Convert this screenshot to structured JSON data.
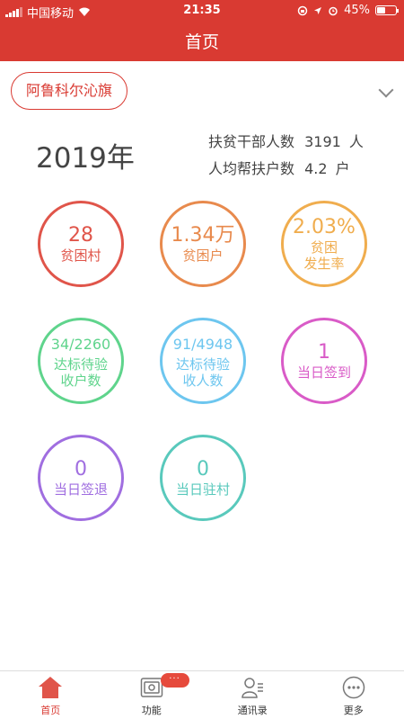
{
  "status_bar": {
    "carrier": "中国移动",
    "time": "21:35",
    "battery": "45%"
  },
  "header": {
    "title": "首页"
  },
  "region": {
    "name": "阿鲁科尔沁旗"
  },
  "summary": {
    "year": "2019年",
    "cadres_label": "扶贫干部人数",
    "cadres_value": "3191",
    "cadres_unit": "人",
    "avg_label": "人均帮扶户数",
    "avg_value": "4.2",
    "avg_unit": "户"
  },
  "metrics": [
    {
      "value": "28",
      "label1": "贫困村",
      "label2": "",
      "color": "#e0554a"
    },
    {
      "value": "1.34万",
      "label1": "贫困户",
      "label2": "",
      "color": "#e88a4d"
    },
    {
      "value": "2.03%",
      "label1": "贫困",
      "label2": "发生率",
      "color": "#f0ad4e"
    },
    {
      "value": "34/2260",
      "label1": "达标待验",
      "label2": "收户数",
      "color": "#5fd48c"
    },
    {
      "value": "91/4948",
      "label1": "达标待验",
      "label2": "收人数",
      "color": "#6dc6ef"
    },
    {
      "value": "1",
      "label1": "当日签到",
      "label2": "",
      "color": "#d95bc7"
    },
    {
      "value": "0",
      "label1": "当日签退",
      "label2": "",
      "color": "#a06ee0"
    },
    {
      "value": "0",
      "label1": "当日驻村",
      "label2": "",
      "color": "#59c9bc"
    }
  ],
  "tabbar": {
    "home": "首页",
    "functions": "功能",
    "functions_badge": "···",
    "contacts": "通讯录",
    "more": "更多"
  },
  "colors": {
    "brand": "#d93a32"
  }
}
